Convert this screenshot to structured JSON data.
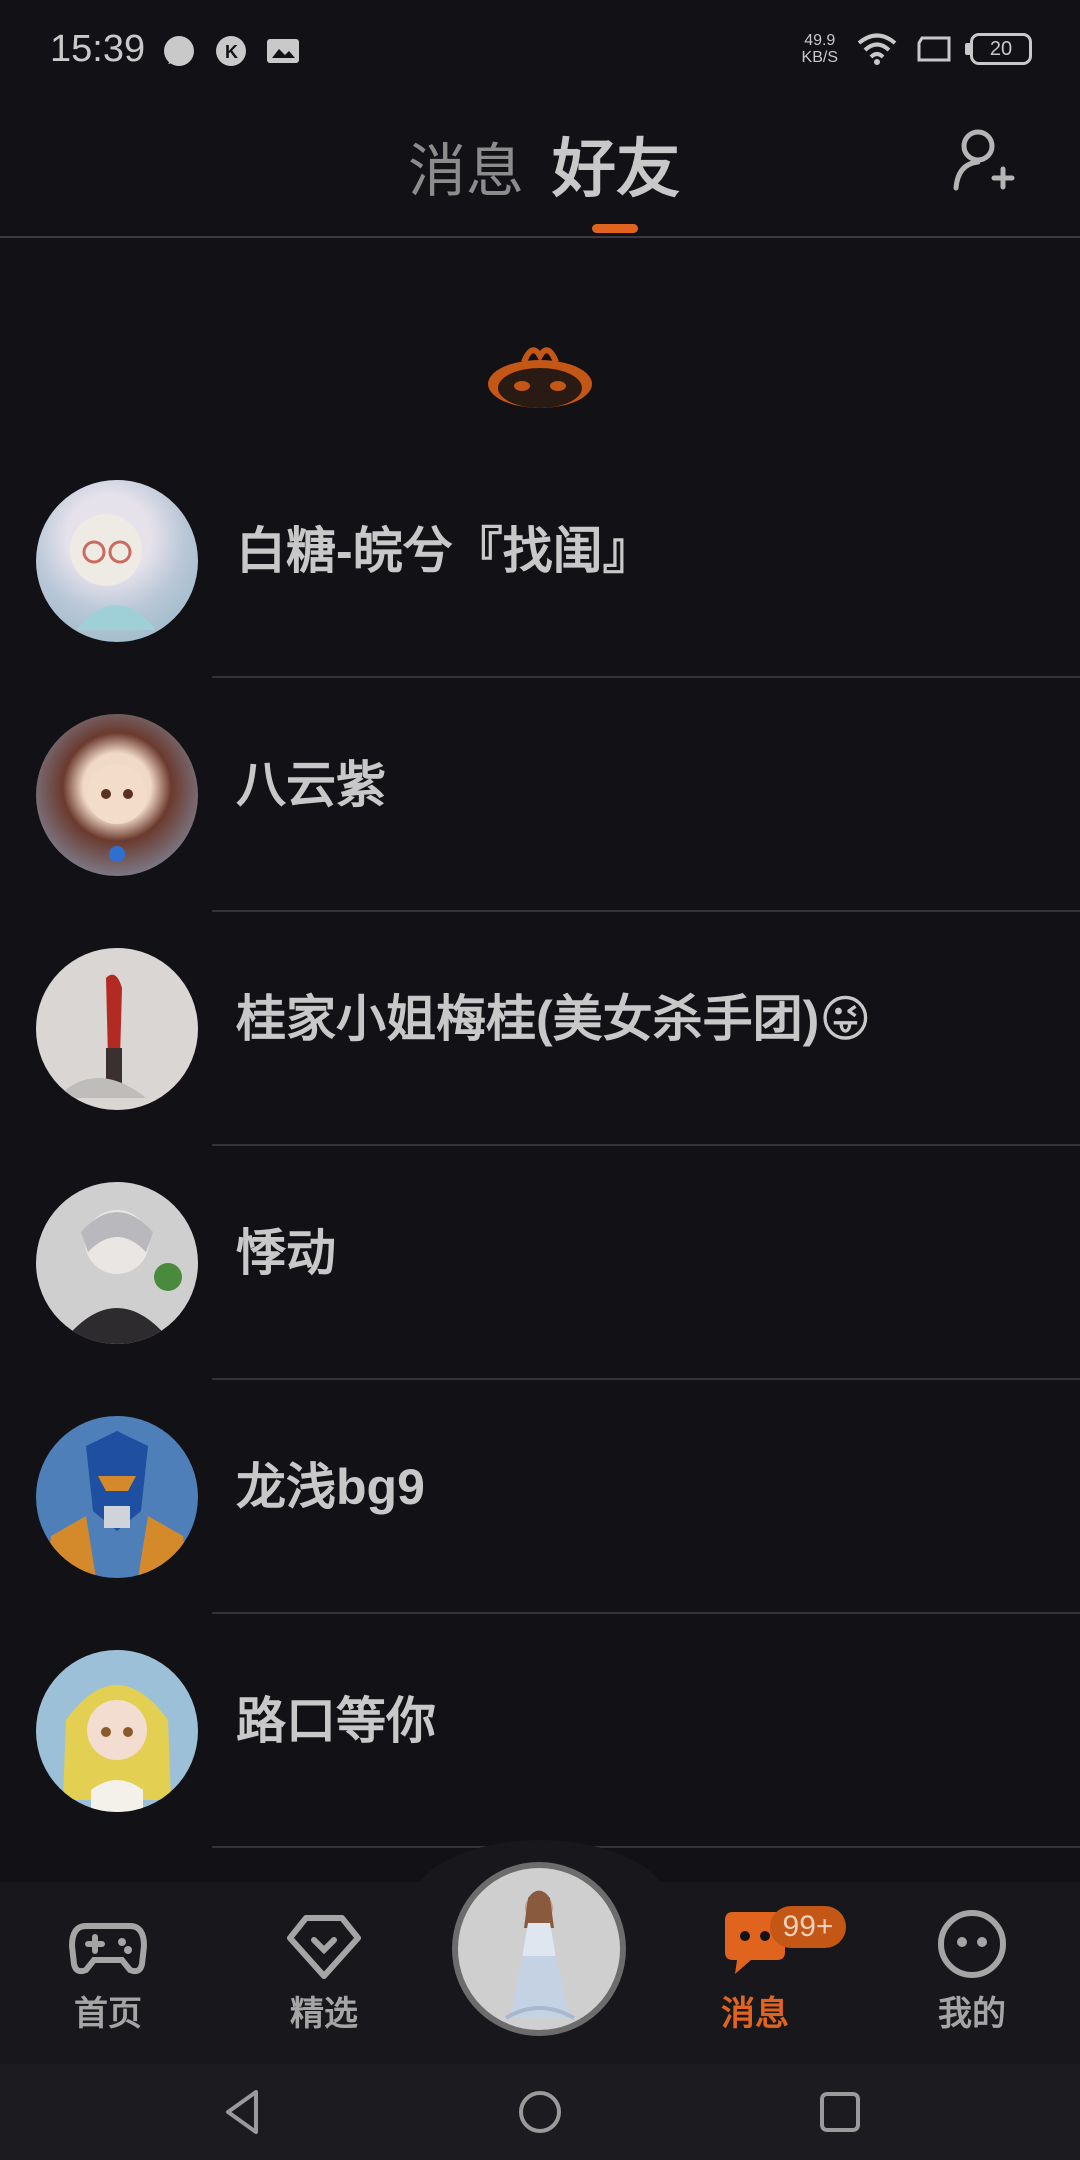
{
  "status_bar": {
    "time": "15:39",
    "net_speed_value": "49.9",
    "net_speed_unit": "KB/S",
    "battery": "20"
  },
  "header": {
    "tabs": [
      {
        "label": "消息",
        "active": false
      },
      {
        "label": "好友",
        "active": true
      }
    ]
  },
  "friends": [
    {
      "name": "白糖-皖兮『找闺』",
      "avatar": "avatar-white-hair-glasses"
    },
    {
      "name": "八云紫",
      "avatar": "avatar-brown-hair-girl"
    },
    {
      "name": "桂家小姐梅桂(美女杀手团)😜",
      "avatar": "avatar-red-hair-figure"
    },
    {
      "name": "悸动",
      "avatar": "avatar-silver-hair-girl"
    },
    {
      "name": "龙浅bg9",
      "avatar": "avatar-blue-mecha"
    },
    {
      "name": "路口等你",
      "avatar": "avatar-blonde-girl"
    }
  ],
  "bottom_nav": {
    "items": [
      {
        "label": "首页",
        "icon": "gamepad-icon",
        "active": false
      },
      {
        "label": "精选",
        "icon": "heart-diamond-icon",
        "active": false
      },
      {
        "label": "消息",
        "icon": "chat-bubble-icon",
        "active": true
      },
      {
        "label": "我的",
        "icon": "smiley-face-icon",
        "active": false
      }
    ],
    "badge": "99+"
  },
  "colors": {
    "accent": "#e0641e",
    "background": "#111116"
  }
}
